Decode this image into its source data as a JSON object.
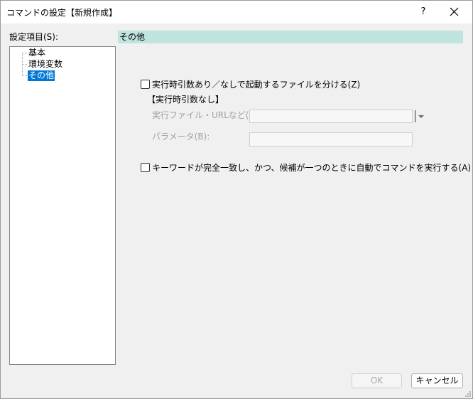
{
  "window": {
    "title": "コマンドの設定【新規作成】",
    "help_glyph": "?",
    "close_icon": "close-icon"
  },
  "sidebar": {
    "label": "設定項目(S):",
    "items": [
      {
        "label": "基本",
        "selected": false
      },
      {
        "label": "環境変数",
        "selected": false
      },
      {
        "label": "その他",
        "selected": true
      }
    ]
  },
  "panel": {
    "header": "その他",
    "header_color": "#bfe3df",
    "split_files_checkbox": {
      "label": "実行時引数あり／なしで起動するファイルを分ける(Z)",
      "checked": false
    },
    "no_args_heading": "【実行時引数なし】",
    "exec_file_label": "実行ファイル・URLなど(Q):",
    "exec_file_value": "",
    "params_label": "パラメータ(B):",
    "params_value": "",
    "auto_exec_checkbox": {
      "label": "キーワードが完全一致し、かつ、候補が一つのときに自動でコマンドを実行する(A)",
      "checked": false
    }
  },
  "footer": {
    "ok_label": "OK",
    "cancel_label": "キャンセル"
  }
}
